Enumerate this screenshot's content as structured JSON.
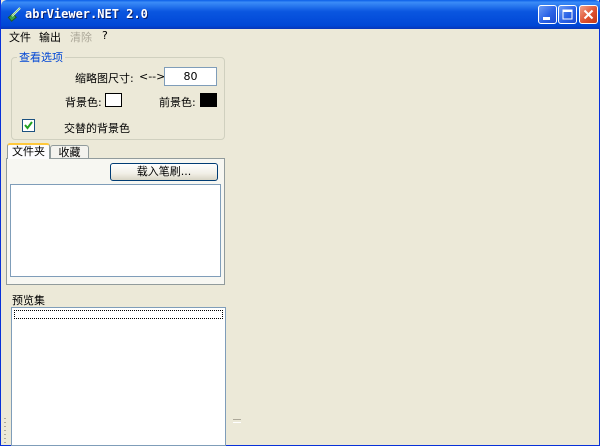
{
  "window": {
    "title": "abrViewer.NET 2.0",
    "controls": {
      "minimize": "minimize",
      "maximize": "maximize",
      "close": "close"
    }
  },
  "menu": {
    "items": [
      {
        "label": "文件",
        "enabled": true
      },
      {
        "label": "输出",
        "enabled": true
      },
      {
        "label": "清除",
        "enabled": false
      },
      {
        "label": "?",
        "enabled": true
      }
    ]
  },
  "view_options": {
    "title": "查看选项",
    "thumb_size_label": "缩略图尺寸:",
    "thumb_size_arrow": "<-->",
    "thumb_size_value": "80",
    "background_label": "背景色:",
    "background_color": "#ffffff",
    "foreground_label": "前景色:",
    "foreground_color": "#000000",
    "alt_bg_label": "交替的背景色",
    "alt_bg_checked": true
  },
  "tabs": [
    {
      "label": "文件夹",
      "active": true
    },
    {
      "label": "收藏",
      "active": false
    }
  ],
  "load_button": "载入笔刷...",
  "preview": {
    "label": "预览集"
  },
  "colors": {
    "accent": "#0046d5",
    "titlebar": "#0a56e0",
    "face": "#ece9d8"
  }
}
